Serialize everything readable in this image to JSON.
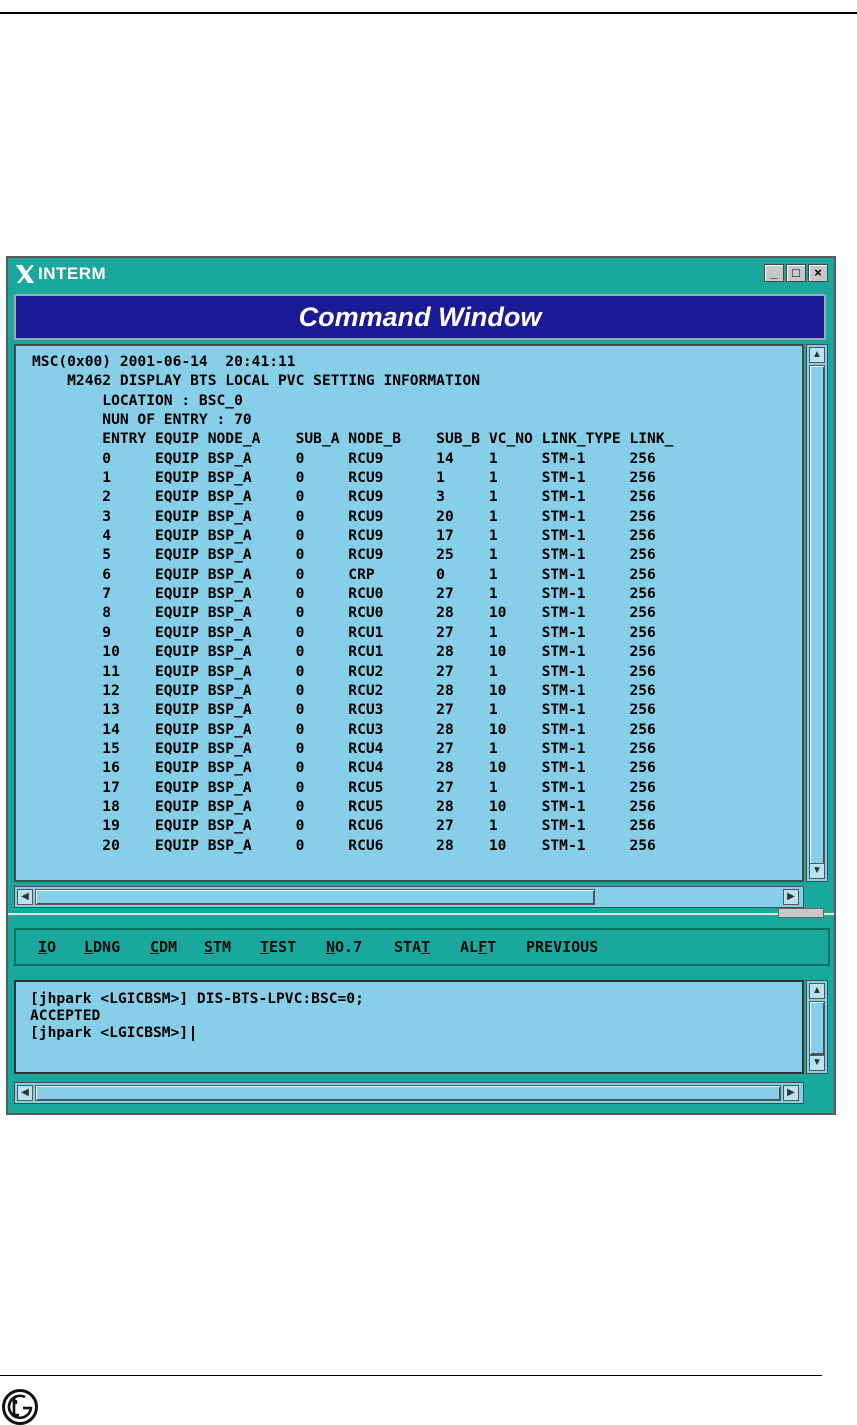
{
  "window": {
    "title": "INTERM",
    "header": "Command Window",
    "buttons": {
      "minimize": "_",
      "maximize": "□",
      "close": "×"
    }
  },
  "output": {
    "lines": [
      "MSC(0x00) 2001-06-14  20:41:11",
      "    M2462 DISPLAY BTS LOCAL PVC SETTING INFORMATION",
      "        LOCATION : BSC_0",
      "        NUN OF ENTRY : 70",
      "        ENTRY EQUIP NODE_A    SUB_A NODE_B    SUB_B VC_NO LINK_TYPE LINK_",
      "        0     EQUIP BSP_A     0     RCU9      14    1     STM-1     256",
      "        1     EQUIP BSP_A     0     RCU9      1     1     STM-1     256",
      "        2     EQUIP BSP_A     0     RCU9      3     1     STM-1     256",
      "        3     EQUIP BSP_A     0     RCU9      20    1     STM-1     256",
      "        4     EQUIP BSP_A     0     RCU9      17    1     STM-1     256",
      "        5     EQUIP BSP_A     0     RCU9      25    1     STM-1     256",
      "        6     EQUIP BSP_A     0     CRP       0     1     STM-1     256",
      "        7     EQUIP BSP_A     0     RCU0      27    1     STM-1     256",
      "        8     EQUIP BSP_A     0     RCU0      28    10    STM-1     256",
      "        9     EQUIP BSP_A     0     RCU1      27    1     STM-1     256",
      "        10    EQUIP BSP_A     0     RCU1      28    10    STM-1     256",
      "        11    EQUIP BSP_A     0     RCU2      27    1     STM-1     256",
      "        12    EQUIP BSP_A     0     RCU2      28    10    STM-1     256",
      "        13    EQUIP BSP_A     0     RCU3      27    1     STM-1     256",
      "        14    EQUIP BSP_A     0     RCU3      28    10    STM-1     256",
      "        15    EQUIP BSP_A     0     RCU4      27    1     STM-1     256",
      "        16    EQUIP BSP_A     0     RCU4      28    10    STM-1     256",
      "        17    EQUIP BSP_A     0     RCU5      27    1     STM-1     256",
      "        18    EQUIP BSP_A     0     RCU5      28    10    STM-1     256",
      "        19    EQUIP BSP_A     0     RCU6      27    1     STM-1     256",
      "        20    EQUIP BSP_A     0     RCU6      28    10    STM-1     256"
    ]
  },
  "menu": {
    "items": [
      {
        "pre": "",
        "u": "I",
        "post": "O"
      },
      {
        "pre": "",
        "u": "L",
        "post": "DNG"
      },
      {
        "pre": "",
        "u": "C",
        "post": "DM"
      },
      {
        "pre": "",
        "u": "S",
        "post": "TM"
      },
      {
        "pre": "",
        "u": "T",
        "post": "EST"
      },
      {
        "pre": "",
        "u": "N",
        "post": "O.7"
      },
      {
        "pre": "STA",
        "u": "T",
        "post": ""
      },
      {
        "pre": "AL",
        "u": "F",
        "post": "T"
      },
      {
        "pre": "PREVIOUS",
        "u": "",
        "post": ""
      }
    ]
  },
  "input": {
    "lines": [
      "[jhpark <LGICBSM>] DIS-BTS-LPVC:BSC=0;",
      "ACCEPTED"
    ],
    "prompt": "[jhpark <LGICBSM>]"
  }
}
